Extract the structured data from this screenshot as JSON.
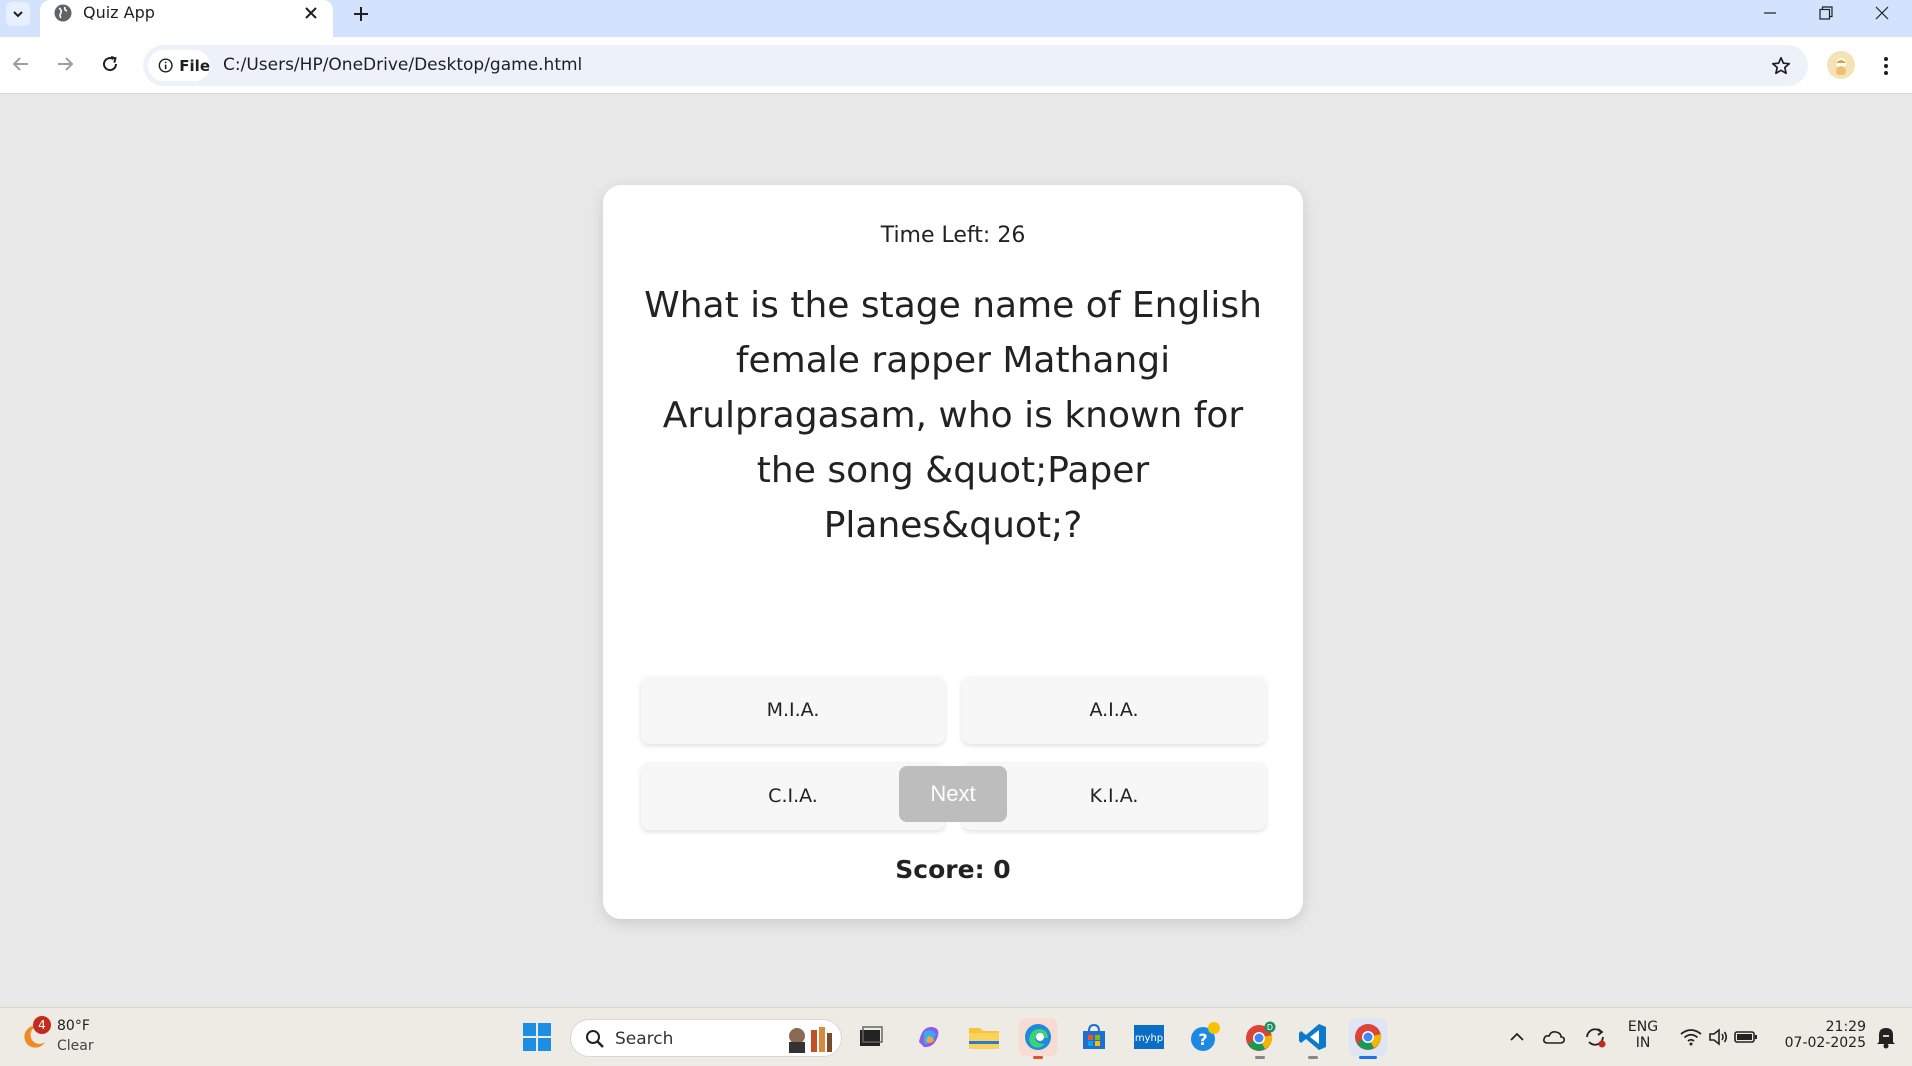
{
  "browser": {
    "tab_title": "Quiz App",
    "file_chip": "File",
    "url": "C:/Users/HP/OneDrive/Desktop/game.html"
  },
  "quiz": {
    "timer_text": "Time Left: 26",
    "question": "What is the stage name of English female rapper Mathangi Arulpragasam, who is known for the song &quot;Paper Planes&quot;?",
    "answers": [
      "M.I.A.",
      "A.I.A.",
      "C.I.A.",
      "K.I.A."
    ],
    "next_label": "Next",
    "score_text": "Score: 0"
  },
  "taskbar": {
    "weather_badge": "4",
    "weather_temp": "80°F",
    "weather_condition": "Clear",
    "search_placeholder": "Search",
    "language_line1": "ENG",
    "language_line2": "IN",
    "time": "21:29",
    "date": "07-02-2025"
  }
}
